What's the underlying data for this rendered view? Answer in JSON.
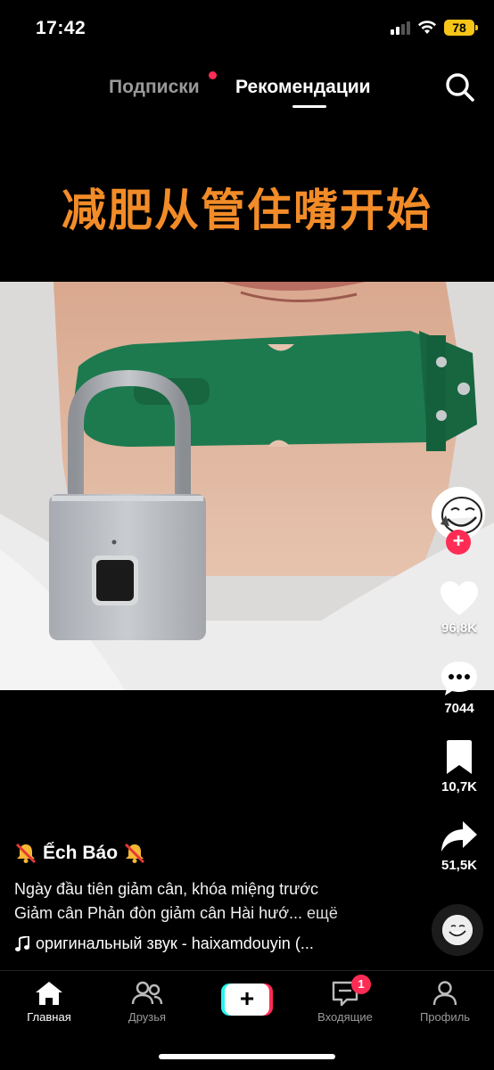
{
  "status_bar": {
    "time": "17:42",
    "battery": "78",
    "icons": [
      "signal-icon",
      "wifi-icon",
      "battery-icon"
    ]
  },
  "top_nav": {
    "tabs": [
      {
        "label": "Подписки",
        "active": false,
        "has_dot": true
      },
      {
        "label": "Рекомендации",
        "active": true
      }
    ],
    "search_icon": "search-icon"
  },
  "video": {
    "overlay_text": "减肥从管住嘴开始",
    "overlay_color": "#f28c28"
  },
  "actions": {
    "likes": "96,8K",
    "comments": "7044",
    "saves": "10,7K",
    "shares": "51,5K"
  },
  "post": {
    "username": "Ếch Báo",
    "description_line1": "Ngày đầu tiên giảm cân, khóa miệng trước",
    "description_line2": "Giảm cân Phản đòn giảm cân Hài hướ...",
    "more_label": "ещё",
    "sound": "оригинальный звук - haixamdouyin (..."
  },
  "tab_bar": {
    "items": [
      {
        "label": "Главная",
        "active": true
      },
      {
        "label": "Друзья",
        "active": false
      },
      {
        "label": "",
        "active": false
      },
      {
        "label": "Входящие",
        "active": false,
        "badge": "1"
      },
      {
        "label": "Профиль",
        "active": false
      }
    ]
  },
  "colors": {
    "accent": "#fe2c55",
    "cyan": "#25f4ee",
    "battery": "#f5c518"
  }
}
